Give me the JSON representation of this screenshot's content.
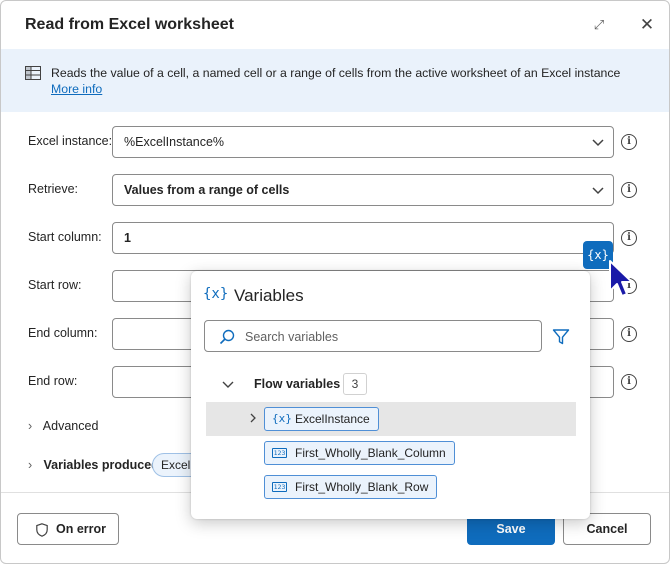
{
  "dialog": {
    "title": "Read from Excel worksheet",
    "expand_icon": "⤢",
    "close_icon": "✕"
  },
  "banner": {
    "text": "Reads the value of a cell, a named cell or a range of cells from the active worksheet of an Excel instance",
    "link": "More info"
  },
  "fields": {
    "excel_instance": {
      "label": "Excel instance:",
      "value": "%ExcelInstance%"
    },
    "retrieve": {
      "label": "Retrieve:",
      "value": "Values from a range of cells"
    },
    "start_column": {
      "label": "Start column:",
      "value": "1"
    },
    "start_row": {
      "label": "Start row:",
      "value": ""
    },
    "end_column": {
      "label": "End column:",
      "value": ""
    },
    "end_row": {
      "label": "End row:",
      "value": ""
    }
  },
  "sections": {
    "advanced": "Advanced",
    "variables_produced": "Variables produced",
    "produced_chip": "ExcelData"
  },
  "footer": {
    "on_error": "On error",
    "save": "Save",
    "cancel": "Cancel"
  },
  "variables_panel": {
    "trigger_label": "{x}",
    "icon": "{x}",
    "title": "Variables",
    "search_placeholder": "Search variables",
    "group": {
      "label": "Flow variables",
      "count": "3"
    },
    "items": [
      {
        "name": "ExcelInstance",
        "type_icon": "{x}"
      },
      {
        "name": "First_Wholly_Blank_Column",
        "type_icon": "123"
      },
      {
        "name": "First_Wholly_Blank_Row",
        "type_icon": "123"
      }
    ]
  },
  "colors": {
    "accent": "#0f6cbd",
    "banner_bg": "#eaf2fb",
    "selected_row": "#e6e6e6"
  }
}
